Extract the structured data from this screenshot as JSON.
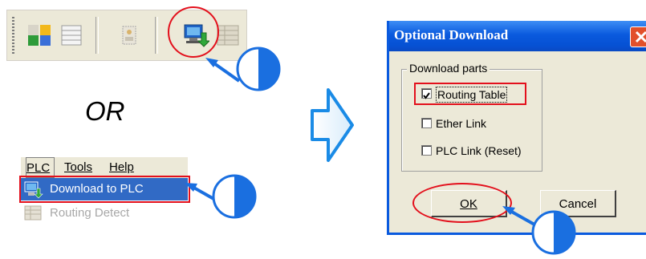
{
  "toolbar": {
    "buttons": [
      "add-node-icon",
      "table-icon",
      "device-icon",
      "download-icon",
      "routing-icon"
    ]
  },
  "or_text": "OR",
  "menu": {
    "bar": [
      {
        "label": "PLC",
        "underline_letter": "P"
      },
      {
        "label": "Tools",
        "underline_letter": "T"
      },
      {
        "label": "Help",
        "underline_letter": "H"
      }
    ],
    "items": [
      {
        "label": "Download to PLC",
        "icon": "download-icon",
        "highlighted": true,
        "enabled": true
      },
      {
        "label": "Routing Detect",
        "icon": "routing-icon",
        "highlighted": false,
        "enabled": false
      }
    ]
  },
  "dialog": {
    "title": "Optional Download",
    "group_label": "Download parts",
    "options": [
      {
        "label": "Routing Table",
        "checked": true
      },
      {
        "label": "Ether Link",
        "checked": false
      },
      {
        "label": "PLC Link (Reset)",
        "checked": false
      }
    ],
    "ok_label": "OK",
    "cancel_label": "Cancel"
  },
  "colors": {
    "highlight_red": "#e3101c",
    "pointer_blue": "#1a6fe0",
    "arrow_blue": "#1a8be6",
    "menu_selection": "#316ac5",
    "dialog_face": "#ece9d8"
  }
}
